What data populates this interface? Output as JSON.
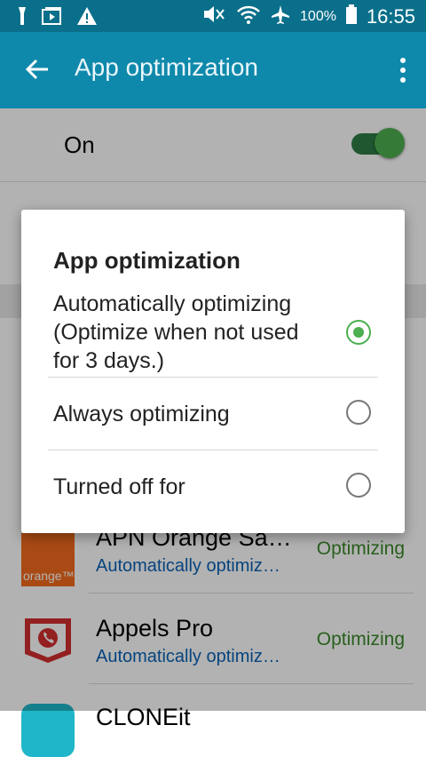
{
  "status_bar": {
    "battery_text": "100%",
    "time": "16:55"
  },
  "app_bar": {
    "title": "App optimization"
  },
  "main_toggle": {
    "label": "On",
    "state": "on"
  },
  "apps": [
    {
      "name": "APN Orange Sa…",
      "sub": "Automatically optimiz…",
      "status": "Optimizing",
      "icon_label": "orange™",
      "icon": "orange-app-icon"
    },
    {
      "name": "Appels Pro",
      "sub": "Automatically optimiz…",
      "status": "Optimizing",
      "icon": "appels-pro-icon"
    },
    {
      "name": "CLONEit",
      "icon": "cloneit-icon"
    }
  ],
  "dialog": {
    "title": "App optimization",
    "options": [
      {
        "label_line1": "Automatically optimizing",
        "label_line2": "(Optimize when not used",
        "label_line3": "for 3 days.)",
        "selected": true
      },
      {
        "label": "Always optimizing",
        "selected": false
      },
      {
        "label": "Turned off for",
        "selected": false
      }
    ]
  },
  "colors": {
    "status_bar": "#0a6f8a",
    "app_bar": "#0f89ab",
    "accent_green": "#4caf50",
    "link_blue": "#0a62b5"
  }
}
